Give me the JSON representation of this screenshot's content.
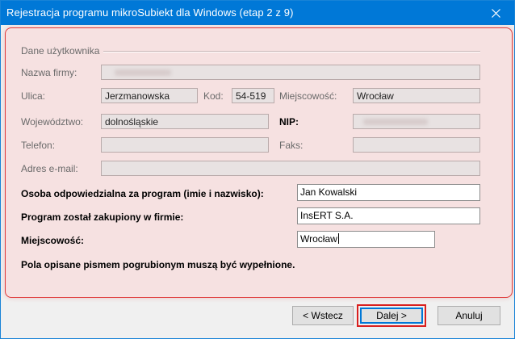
{
  "window": {
    "title": "Rejestracja programu mikroSubiekt dla Windows (etap 2 z 9)"
  },
  "group": {
    "legend": "Dane użytkownika"
  },
  "fields": {
    "company": {
      "label": "Nazwa firmy:",
      "value": ""
    },
    "street": {
      "label": "Ulica:",
      "value": "Jerzmanowska"
    },
    "postcode": {
      "label": "Kod:",
      "value": "54-519"
    },
    "city": {
      "label": "Miejscowość:",
      "value": "Wrocław"
    },
    "province": {
      "label": "Województwo:",
      "value": "dolnośląskie"
    },
    "nip": {
      "label": "NIP:",
      "value": ""
    },
    "phone": {
      "label": "Telefon:",
      "value": ""
    },
    "fax": {
      "label": "Faks:",
      "value": ""
    },
    "email": {
      "label": "Adres e-mail:",
      "value": ""
    },
    "responsible": {
      "label": "Osoba odpowiedzialna za program (imie i nazwisko):",
      "value": "Jan Kowalski"
    },
    "purchased_at": {
      "label": "Program został zakupiony w firmie:",
      "value": "InsERT S.A."
    },
    "place": {
      "label": "Miejscowość:",
      "value": "Wrocław"
    }
  },
  "note": "Pola opisane pismem pogrubionym muszą być wypełnione.",
  "buttons": {
    "back": "< Wstecz",
    "next": "Dalej >",
    "cancel": "Anuluj"
  },
  "icons": {
    "close": "close-icon"
  },
  "colors": {
    "titlebar": "#0078d7",
    "highlight": "#d9201f"
  }
}
